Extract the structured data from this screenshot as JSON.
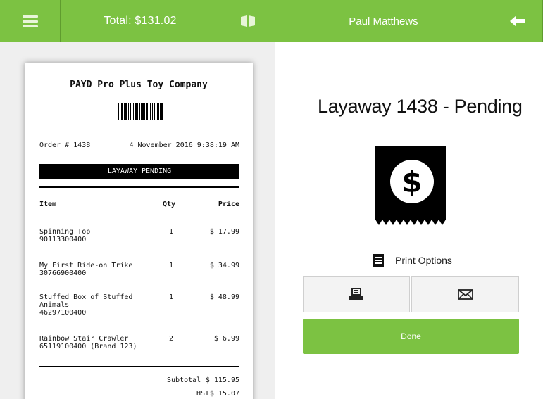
{
  "topbar": {
    "menu_icon": "hamburger-menu-icon",
    "total_label": "Total: $131.02",
    "drawer_icon": "cash-drawer-icon",
    "customer_name": "Paul Matthews",
    "back_icon": "arrow-left-icon",
    "accent_color": "#7cc242"
  },
  "receipt": {
    "company": "PAYD Pro Plus Toy Company",
    "order_label": "Order # 1438",
    "date": "4 November 2016 9:38:19 AM",
    "status": "LAYAWAY PENDING",
    "headers": {
      "item": "Item",
      "qty": "Qty",
      "price": "Price"
    },
    "items": [
      {
        "name": "Spinning Top\n90113300400",
        "qty": "1",
        "price": "$ 17.99"
      },
      {
        "name": "My First Ride-on Trike\n30766900400",
        "qty": "1",
        "price": "$ 34.99"
      },
      {
        "name": "Stuffed Box of Stuffed\nAnimals\n46297100400",
        "qty": "1",
        "price": "$ 48.99"
      },
      {
        "name": "Rainbow Stair Crawler\n65119100400 (Brand 123)",
        "qty": "2",
        "price": "$ 6.99"
      }
    ],
    "subtotal_label": "Subtotal",
    "subtotal": "$ 115.95",
    "tax_label": "HST",
    "tax": "$ 15.07"
  },
  "main": {
    "title": "Layaway 1438 - Pending",
    "receipt_icon": "dollar-receipt-icon",
    "print_options_icon": "document-icon",
    "print_options_label": "Print Options",
    "print_button_icon": "printer-icon",
    "email_button_icon": "envelope-icon",
    "done_label": "Done"
  }
}
